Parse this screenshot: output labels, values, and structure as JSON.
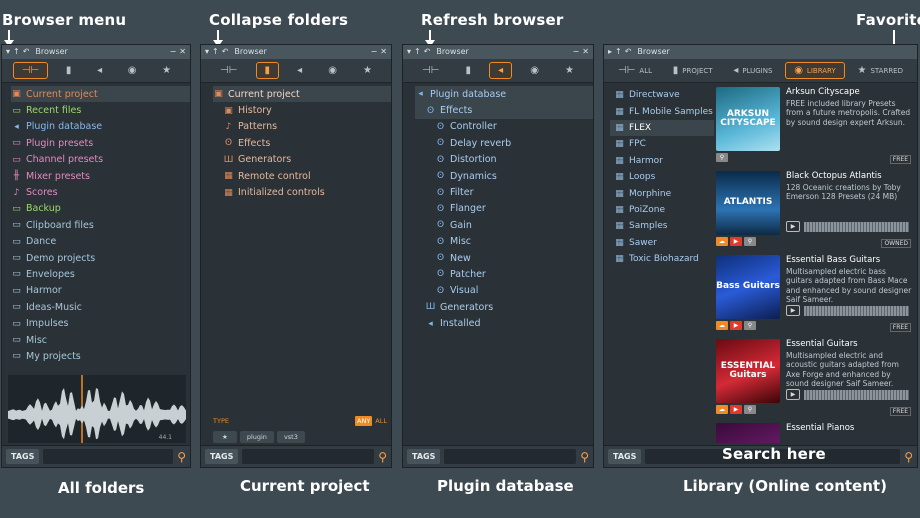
{
  "callouts": {
    "browser_menu": "Browser menu",
    "collapse_folders": "Collapse folders",
    "refresh_browser": "Refresh browser",
    "favorite": "Favorite",
    "search_here": "Search here"
  },
  "labels": {
    "all_folders": "All folders",
    "current_project": "Current project",
    "plugin_database": "Plugin database",
    "library": "Library (Online content)"
  },
  "window_title": "Browser",
  "common": {
    "tags": "TAGS"
  },
  "panel1": {
    "items": [
      {
        "label": "Current project",
        "icon": "▣",
        "color": "#e08a5a"
      },
      {
        "label": "Recent files",
        "icon": "▭",
        "color": "#9bd86a"
      },
      {
        "label": "Plugin database",
        "icon": "◂",
        "color": "#8ab8e8"
      },
      {
        "label": "Plugin presets",
        "icon": "▭",
        "color": "#e48ac0"
      },
      {
        "label": "Channel presets",
        "icon": "▭",
        "color": "#e48ac0"
      },
      {
        "label": "Mixer presets",
        "icon": "╫",
        "color": "#e48ac0"
      },
      {
        "label": "Scores",
        "icon": "♪",
        "color": "#e48ac0"
      },
      {
        "label": "Backup",
        "icon": "▭",
        "color": "#9bd86a"
      },
      {
        "label": "Clipboard files",
        "icon": "▭",
        "color": "#a7c7d9"
      },
      {
        "label": "Dance",
        "icon": "▭",
        "color": "#a7c7d9"
      },
      {
        "label": "Demo projects",
        "icon": "▭",
        "color": "#a7c7d9"
      },
      {
        "label": "Envelopes",
        "icon": "▭",
        "color": "#a7c7d9"
      },
      {
        "label": "Harmor",
        "icon": "▭",
        "color": "#a7c7d9"
      },
      {
        "label": "Ideas-Music",
        "icon": "▭",
        "color": "#a7c7d9"
      },
      {
        "label": "Impulses",
        "icon": "▭",
        "color": "#a7c7d9"
      },
      {
        "label": "Misc",
        "icon": "▭",
        "color": "#a7c7d9"
      },
      {
        "label": "My projects",
        "icon": "▭",
        "color": "#a7c7d9"
      }
    ],
    "sample_info": "44.1"
  },
  "panel2": {
    "items": [
      {
        "label": "Current project",
        "icon": "▣",
        "color": "#e08a5a",
        "indent": 0
      },
      {
        "label": "History",
        "icon": "▣",
        "color": "#e08a5a",
        "indent": 1
      },
      {
        "label": "Patterns",
        "icon": "♪",
        "color": "#e08a5a",
        "indent": 1
      },
      {
        "label": "Effects",
        "icon": "ʘ",
        "color": "#e08a5a",
        "indent": 1
      },
      {
        "label": "Generators",
        "icon": "Ш",
        "color": "#e08a5a",
        "indent": 1
      },
      {
        "label": "Remote control",
        "icon": "▦",
        "color": "#e08a5a",
        "indent": 1
      },
      {
        "label": "Initialized controls",
        "icon": "▦",
        "color": "#e08a5a",
        "indent": 1
      }
    ],
    "type_label": "TYPE",
    "any": "ANY",
    "all": "ALL",
    "tag_buttons": [
      "★",
      "plugin",
      "vst3"
    ]
  },
  "panel3": {
    "items": [
      {
        "label": "Plugin database",
        "icon": "◂",
        "indent": 0
      },
      {
        "label": "Effects",
        "icon": "ʘ",
        "indent": 1
      },
      {
        "label": "Controller",
        "icon": "ʘ",
        "indent": 2
      },
      {
        "label": "Delay reverb",
        "icon": "ʘ",
        "indent": 2
      },
      {
        "label": "Distortion",
        "icon": "ʘ",
        "indent": 2
      },
      {
        "label": "Dynamics",
        "icon": "ʘ",
        "indent": 2
      },
      {
        "label": "Filter",
        "icon": "ʘ",
        "indent": 2
      },
      {
        "label": "Flanger",
        "icon": "ʘ",
        "indent": 2
      },
      {
        "label": "Gain",
        "icon": "ʘ",
        "indent": 2
      },
      {
        "label": "Misc",
        "icon": "ʘ",
        "indent": 2
      },
      {
        "label": "New",
        "icon": "ʘ",
        "indent": 2
      },
      {
        "label": "Patcher",
        "icon": "ʘ",
        "indent": 2
      },
      {
        "label": "Visual",
        "icon": "ʘ",
        "indent": 2
      },
      {
        "label": "Generators",
        "icon": "Ш",
        "indent": 1
      },
      {
        "label": "Installed",
        "icon": "◂",
        "indent": 1
      }
    ]
  },
  "panel4": {
    "tabs": [
      "ALL",
      "PROJECT",
      "PLUGINS",
      "LIBRARY",
      "STARRED"
    ],
    "folders": [
      "Directwave",
      "FL Mobile Samples",
      "FLEX",
      "FPC",
      "Harmor",
      "Loops",
      "Morphine",
      "PoiZone",
      "Samples",
      "Sawer",
      "Toxic Biohazard"
    ],
    "cards": [
      {
        "title": "Arksun Cityscape",
        "desc": "FREE included library Presets from a future metropolis. Crafted by sound design expert Arksun.",
        "art": "ARKSUN\nCITYSCAPE",
        "badge": "FREE",
        "bg": "linear-gradient(160deg,#1c6a82,#59b7d8 60%,#aee0f0)"
      },
      {
        "title": "Black Octopus Atlantis",
        "desc": "128 Oceanic creations by Toby Emerson 128 Presets (24 MB)",
        "art": "ATLANTIS",
        "badge": "OWNED",
        "bg": "linear-gradient(180deg,#0a2a4a,#2d74b4 60%,#0e2a44)"
      },
      {
        "title": "Essential Bass Guitars",
        "desc": "Multisampled electric bass guitars adapted from Bass Mace and enhanced by sound designer Saif Sameer.",
        "art": "Bass Guitars",
        "badge": "FREE",
        "bg": "linear-gradient(160deg,#0f2f7a,#2a5bd8 50%,#0b1e50)"
      },
      {
        "title": "Essential Guitars",
        "desc": "Multisampled electric and acoustic guitars adapted from Axe Forge and enhanced by sound designer Saif Sameer.",
        "art": "ESSENTIAL\nGuitars",
        "badge": "FREE",
        "bg": "linear-gradient(160deg,#6a0a12,#d42a36 55%,#3a0508)"
      },
      {
        "title": "Essential Pianos",
        "desc": "",
        "art": "",
        "badge": "",
        "bg": "linear-gradient(160deg,#3a0a3a,#8a2a8a)"
      }
    ]
  },
  "colors": {
    "accent": "#f08a24",
    "background": "#3e4a52",
    "panel": "#2a3238"
  }
}
